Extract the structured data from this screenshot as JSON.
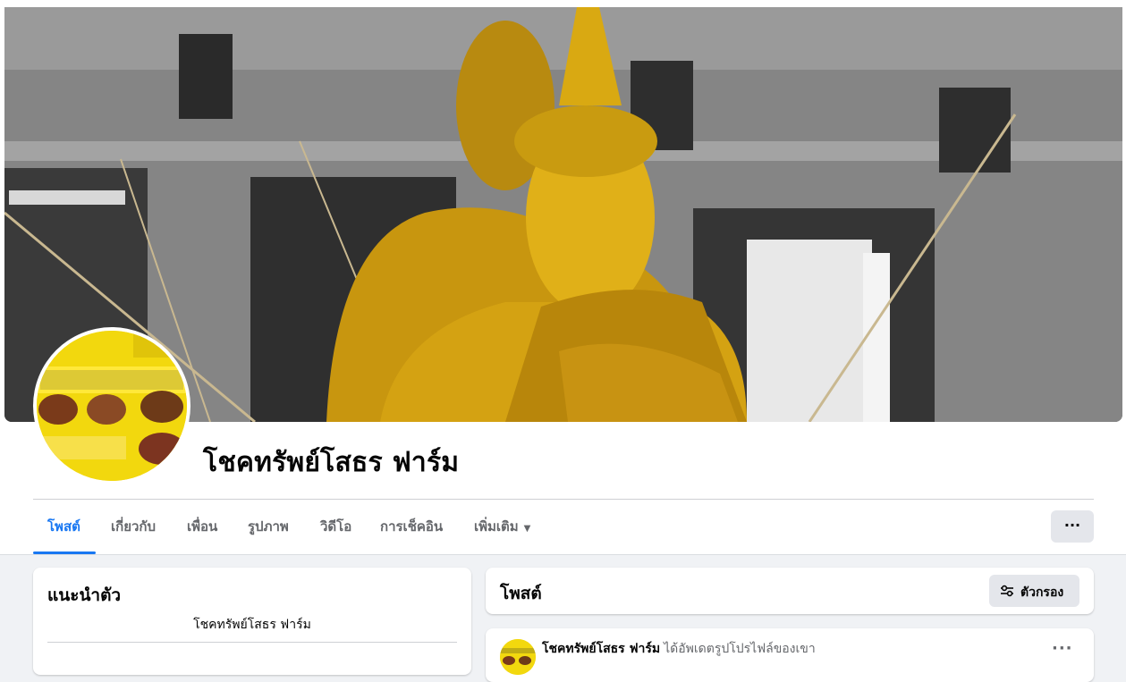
{
  "page": {
    "name": "โชคทรัพย์โสธร ฟาร์ม"
  },
  "tabs": [
    {
      "label": "โพสต์",
      "active": true
    },
    {
      "label": "เกี่ยวกับ"
    },
    {
      "label": "เพื่อน"
    },
    {
      "label": "รูปภาพ"
    },
    {
      "label": "วิดีโอ"
    },
    {
      "label": "การเช็คอิน"
    },
    {
      "label": "เพิ่มเติม"
    }
  ],
  "more_button": {
    "icon": "ellipsis-icon",
    "label": "···"
  },
  "intro": {
    "title": "แนะนำตัว",
    "bio": "โชคทรัพย์โสธร ฟาร์ม"
  },
  "posts": {
    "title": "โพสต์",
    "filter_label": "ตัวกรอง",
    "filter_icon": "sliders-icon"
  },
  "post": {
    "author": "โชคทรัพย์โสธร ฟาร์ม",
    "action": "ได้อัพเดตรูปโปรไฟล์ของเขา",
    "more_label": "···"
  },
  "colors": {
    "accent": "#1877f2",
    "background": "#f0f2f5",
    "secondary_text": "#65676b",
    "button_gray": "#e4e6eb"
  }
}
